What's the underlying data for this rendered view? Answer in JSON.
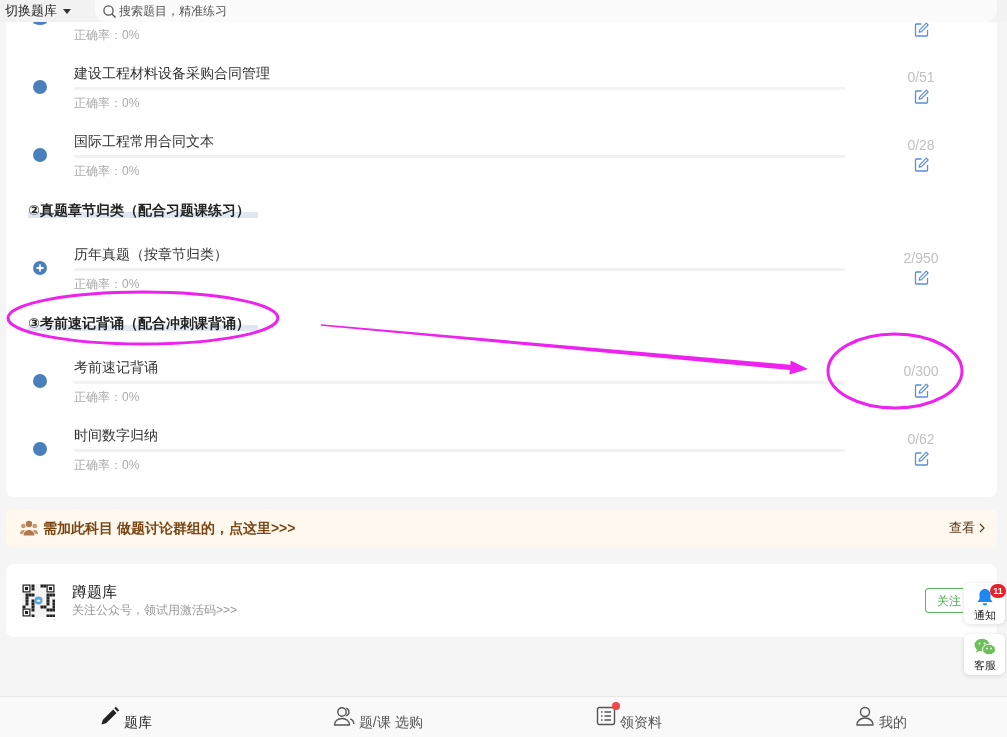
{
  "header": {
    "switch_label": "切换题库",
    "search": {
      "placeholder": "搜索题目，精准练习"
    }
  },
  "sections": [
    {
      "circled": false,
      "items": [
        {
          "kind": "leaf",
          "accuracy": "正确率：0%",
          "count_circled": false
        },
        {
          "kind": "leaf",
          "title": "建设工程材料设备采购合同管理",
          "accuracy": "正确率：0%",
          "count": "0/51",
          "count_circled": false
        },
        {
          "kind": "leaf",
          "title": "国际工程常用合同文本",
          "accuracy": "正确率：0%",
          "count": "0/28",
          "count_circled": false
        }
      ]
    },
    {
      "title": "②真题章节归类（配合习题课练习）",
      "circled": false,
      "items": [
        {
          "kind": "group",
          "title": "历年真题（按章节归类）",
          "accuracy": "正确率：0%",
          "count": "2/950",
          "count_circled": false
        }
      ]
    },
    {
      "title": "③考前速记背诵（配合冲刺课背诵）",
      "circled": true,
      "items": [
        {
          "kind": "leaf",
          "title": "考前速记背诵",
          "accuracy": "正确率：0%",
          "count": "0/300",
          "count_circled": true
        },
        {
          "kind": "leaf",
          "title": "时间数字归纳",
          "accuracy": "正确率：0%",
          "count": "0/62",
          "count_circled": false
        }
      ]
    }
  ],
  "annotation_arrow": true,
  "group_banner": {
    "text": "需加此科目 做题讨论群组的，点这里>>>",
    "link": "查看"
  },
  "follow_card": {
    "title": "蹲题库",
    "subtitle": "关注公众号，领试用激活码>>>",
    "button": "关注"
  },
  "float_buttons": [
    {
      "kind": "notice",
      "label": "通知",
      "badge": "11"
    },
    {
      "kind": "service",
      "label": "客服"
    }
  ],
  "tabs": [
    {
      "kind": "bank",
      "label": "题库",
      "selected": true,
      "dot": false
    },
    {
      "kind": "shop",
      "label": "题/课 选购",
      "selected": false,
      "dot": false
    },
    {
      "kind": "materials",
      "label": "领资料",
      "selected": false,
      "dot": true
    },
    {
      "kind": "profile",
      "label": "我的",
      "selected": false,
      "dot": false
    }
  ]
}
